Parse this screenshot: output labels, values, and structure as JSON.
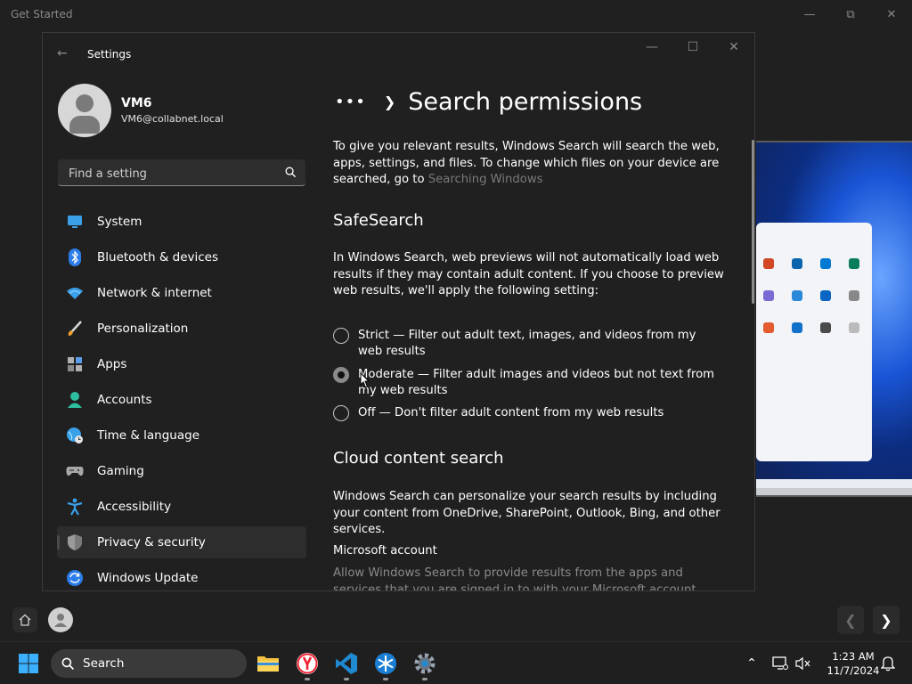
{
  "background_window": {
    "title": "Get Started"
  },
  "window": {
    "title": "Settings"
  },
  "user": {
    "name": "VM6",
    "email": "VM6@collabnet.local"
  },
  "search": {
    "placeholder": "Find a setting"
  },
  "nav": {
    "items": [
      {
        "label": "System",
        "icon": "monitor-icon"
      },
      {
        "label": "Bluetooth & devices",
        "icon": "bluetooth-icon"
      },
      {
        "label": "Network & internet",
        "icon": "wifi-icon"
      },
      {
        "label": "Personalization",
        "icon": "brush-icon"
      },
      {
        "label": "Apps",
        "icon": "apps-icon"
      },
      {
        "label": "Accounts",
        "icon": "person-icon"
      },
      {
        "label": "Time & language",
        "icon": "globe-clock-icon"
      },
      {
        "label": "Gaming",
        "icon": "gamepad-icon"
      },
      {
        "label": "Accessibility",
        "icon": "accessibility-icon"
      },
      {
        "label": "Privacy & security",
        "icon": "shield-icon"
      },
      {
        "label": "Windows Update",
        "icon": "update-icon"
      }
    ],
    "active": "Privacy & security"
  },
  "content": {
    "breadcrumb_dots": "•••",
    "page_title": "Search permissions",
    "intro": "To give you relevant results, Windows Search will search the web, apps, settings, and files. To change which files on your device are searched, go to",
    "intro_link": "Searching Windows",
    "safesearch": {
      "heading": "SafeSearch",
      "description": "In Windows Search, web previews will not automatically load web results if they may contain adult content. If you choose to preview web results, we'll apply the following setting:",
      "options": [
        {
          "label": "Strict — Filter out adult text, images, and videos from my web results",
          "selected": false
        },
        {
          "label": "Moderate — Filter adult images and videos but not text from my web results",
          "selected": true
        },
        {
          "label": "Off — Don't filter adult content from my web results",
          "selected": false
        }
      ]
    },
    "cloud": {
      "heading": "Cloud content search",
      "description": "Windows Search can personalize your search results by including your content from OneDrive, SharePoint, Outlook, Bing, and other services.",
      "account_heading": "Microsoft account",
      "account_description": "Allow Windows Search to provide results from the apps and services that you are signed in to with your Microsoft account"
    }
  },
  "taskbar": {
    "search_label": "Search",
    "time": "1:23 AM",
    "date": "11/7/2024"
  },
  "colors": {
    "accent_blue": "#0078d4",
    "window_bg": "#202020",
    "taskbar_bg": "#1f1f1f"
  }
}
